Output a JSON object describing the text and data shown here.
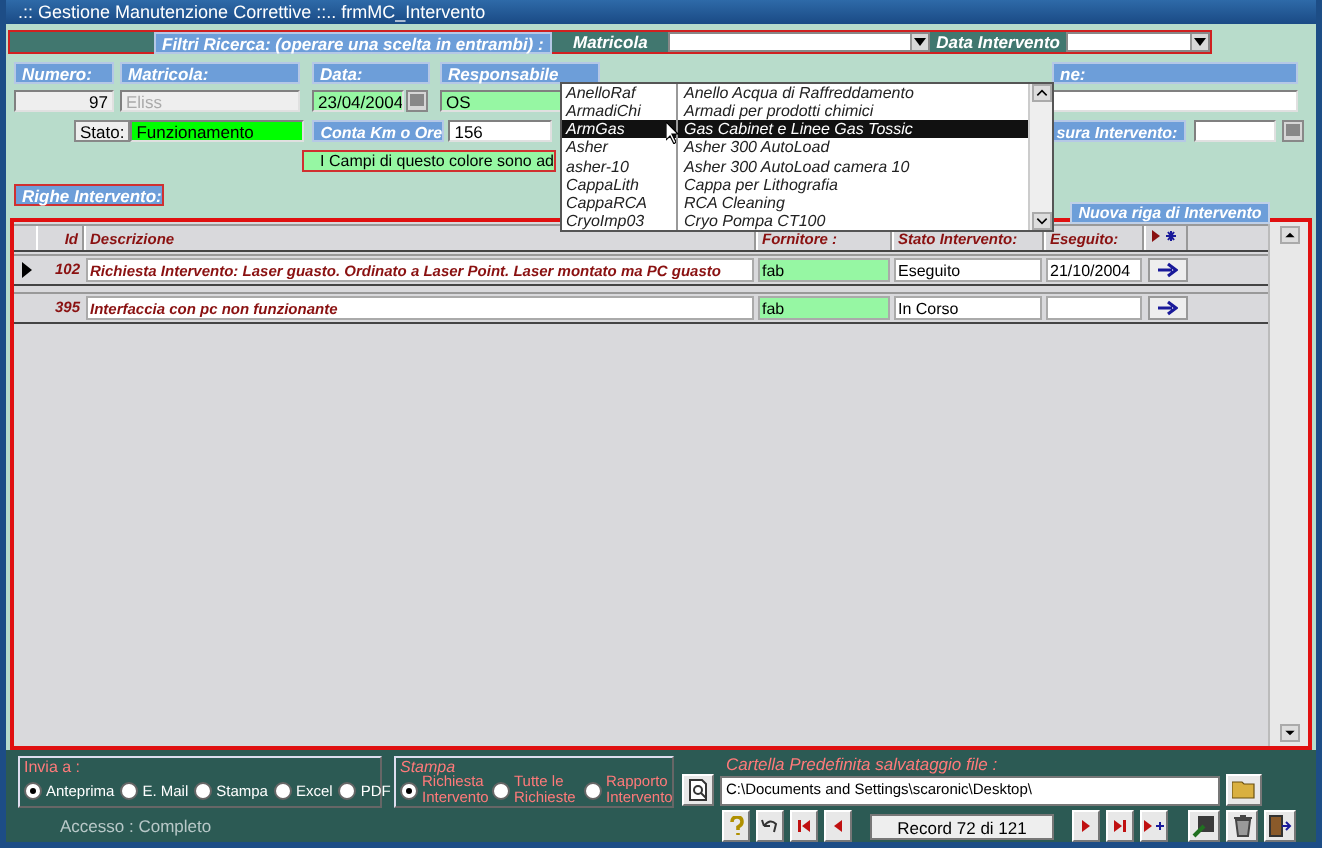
{
  "window": {
    "title": ".:: Gestione Manutenzione  Correttive ::..  frmMC_Intervento"
  },
  "filter_bar": {
    "label": "Filtri Ricerca: (operare una scelta in  entrambi) :",
    "matricola_label": "Matricola",
    "date_label": "Data Intervento"
  },
  "matricola_list": {
    "items": [
      {
        "code": "AnelloRaf",
        "name": "Anello Acqua di Raffreddamento",
        "selected": false
      },
      {
        "code": "ArmadiChi",
        "name": "Armadi per prodotti chimici",
        "selected": false
      },
      {
        "code": "ArmGas",
        "name": "Gas Cabinet e Linee Gas Tossic",
        "selected": true
      },
      {
        "code": "Asher",
        "name": "Asher 300 AutoLoad",
        "selected": false
      },
      {
        "code": "asher-10",
        "name": "Asher 300 AutoLoad camera 10",
        "selected": false
      },
      {
        "code": "CappaLith",
        "name": "Cappa per Lithografia",
        "selected": false
      },
      {
        "code": "CappaRCA",
        "name": "RCA Cleaning",
        "selected": false
      },
      {
        "code": "CryoImp03",
        "name": "Cryo Pompa CT100",
        "selected": false
      }
    ]
  },
  "form": {
    "numero_label": "Numero:",
    "numero": "97",
    "matricola_label": "Matricola:",
    "matricola": "Eliss",
    "matricola_disabled": true,
    "data_label": "Data:",
    "data": "23/04/2004",
    "responsabile_label": "Responsabile",
    "responsabile": "OS",
    "right_label": "ne:",
    "stato_label": "Stato:",
    "stato": "Funzionamento",
    "conta_label": "Conta Km o Ore",
    "conta": "156",
    "chiusura_label": "sura Intervento:",
    "note": "I Campi di questo colore sono ad"
  },
  "righe_label": "Righe Intervento:",
  "new_row_button": "Nuova riga di Intervento",
  "table": {
    "columns": [
      "Id",
      "Descrizione",
      "Fornitore :",
      "Stato Intervento:",
      "Eseguito:"
    ],
    "rows": [
      {
        "id": "102",
        "descrizione": "Richiesta Intervento: Laser guasto. Ordinato a Laser Point. Laser montato ma PC guasto",
        "fornitore": "fab",
        "stato": "Eseguito",
        "eseguito": "21/10/2004",
        "current": true
      },
      {
        "id": "395",
        "descrizione": "Interfaccia con pc non funzionante",
        "fornitore": "fab",
        "stato": "In Corso",
        "eseguito": "",
        "current": false
      }
    ]
  },
  "send_to": {
    "title": "Invia a :",
    "options": [
      {
        "label": "Anteprima",
        "selected": true
      },
      {
        "label": "E. Mail",
        "selected": false
      },
      {
        "label": "Stampa",
        "selected": false
      },
      {
        "label": "Excel",
        "selected": false
      },
      {
        "label": "PDF",
        "selected": false
      }
    ]
  },
  "print": {
    "title": "Stampa",
    "options": [
      {
        "label": "Richiesta Intervento",
        "selected": true
      },
      {
        "label": "Tutte le Richieste",
        "selected": false
      },
      {
        "label": "Rapporto Intervento",
        "selected": false
      }
    ]
  },
  "folder": {
    "label": "Cartella Predefinita salvataggio file :",
    "path": "C:\\Documents and Settings\\scaronic\\Desktop\\"
  },
  "navigator": {
    "record": "Record 72 di 121"
  },
  "access": "Accesso : Completo"
}
